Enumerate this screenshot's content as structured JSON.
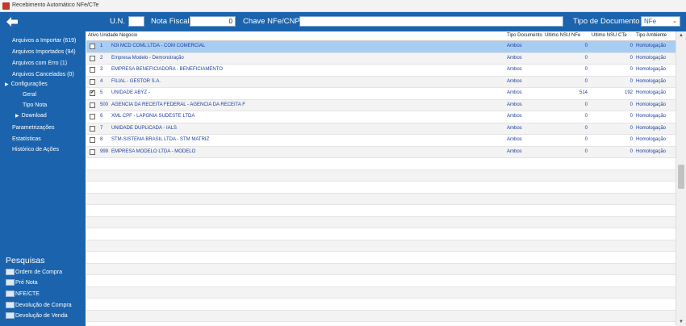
{
  "window": {
    "title": "Recebimento Automático NFe/CTe"
  },
  "topbar": {
    "un_label": "U.N.",
    "un_value": "",
    "nota_label": "Nota Fiscal",
    "nota_value": "0",
    "chave_label": "Chave NFe/CNPJ",
    "chave_value": "",
    "tipo_label": "Tipo de Documento",
    "tipo_value": "NFe"
  },
  "sidebar": {
    "items": [
      {
        "label": "Arquivos a Importar (619)"
      },
      {
        "label": "Arquivos Importados (94)"
      },
      {
        "label": "Arquivos com Erro (1)"
      },
      {
        "label": "Arquivos Cancelados (0)"
      },
      {
        "label": "Configurações"
      },
      {
        "label": "Geral"
      },
      {
        "label": "Tipo Nota"
      },
      {
        "label": "Download"
      },
      {
        "label": "Parametrizações"
      },
      {
        "label": "Estatísticas"
      },
      {
        "label": "Histórico de Ações"
      }
    ],
    "pesquisas_title": "Pesquisas",
    "pesquisas": [
      {
        "label": "Ordem de Compra"
      },
      {
        "label": "Pré Nota"
      },
      {
        "label": "NFE/CTE"
      },
      {
        "label": "Devolução de Compra"
      },
      {
        "label": "Devolução de Venda"
      }
    ]
  },
  "grid": {
    "columns": [
      "Ativo",
      "Unidade Negocio",
      "Tipo Documento",
      "Ultimo NSU NFe",
      "Ultimo NSU CTe",
      "Tipo Ambiente"
    ],
    "rows": [
      {
        "checked": false,
        "code": "1",
        "name": "N3I MCD COML LTDA - COM COMERCIAL",
        "tipo": "Ambos",
        "nsu_nfe": "0",
        "nsu_cte": "0",
        "ambiente": "Homologação"
      },
      {
        "checked": false,
        "code": "2",
        "name": "Empresa Modelo - Demonstração",
        "tipo": "Ambos",
        "nsu_nfe": "0",
        "nsu_cte": "0",
        "ambiente": "Homologação"
      },
      {
        "checked": false,
        "code": "3",
        "name": "EMPRESA BENEFICIADORA - BENEFICIAMENTO",
        "tipo": "Ambos",
        "nsu_nfe": "0",
        "nsu_cte": "0",
        "ambiente": "Homologação"
      },
      {
        "checked": false,
        "code": "4",
        "name": "FILIAL - GESTOR S.A.",
        "tipo": "Ambos",
        "nsu_nfe": "0",
        "nsu_cte": "0",
        "ambiente": "Homologação"
      },
      {
        "checked": true,
        "code": "5",
        "name": "UNIDADE ABYZ -",
        "tipo": "Ambos",
        "nsu_nfe": "514",
        "nsu_cte": "192",
        "ambiente": "Homologação"
      },
      {
        "checked": false,
        "code": "500",
        "name": "AGENCIA DA RECEITA FEDERAL - AGENCIA DA RECEITA F",
        "tipo": "Ambos",
        "nsu_nfe": "0",
        "nsu_cte": "0",
        "ambiente": "Homologação"
      },
      {
        "checked": false,
        "code": "6",
        "name": "XML CPF - LAPONIA SUDESTE LTDA",
        "tipo": "Ambos",
        "nsu_nfe": "0",
        "nsu_cte": "0",
        "ambiente": "Homologação"
      },
      {
        "checked": false,
        "code": "7",
        "name": "UNIDADE DUPLICADA - IALS",
        "tipo": "Ambos",
        "nsu_nfe": "0",
        "nsu_cte": "0",
        "ambiente": "Homologação"
      },
      {
        "checked": false,
        "code": "8",
        "name": "STM-SISTEMA BRASIL LTDA - STM MATRIZ",
        "tipo": "Ambos",
        "nsu_nfe": "0",
        "nsu_cte": "0",
        "ambiente": "Homologação"
      },
      {
        "checked": false,
        "code": "999",
        "name": "EMPRESA MODELO LTDA - MODELO",
        "tipo": "Ambos",
        "nsu_nfe": "0",
        "nsu_cte": "0",
        "ambiente": "Homologação"
      }
    ],
    "empty_rows": 14
  },
  "colors": {
    "primary": "#1b64ad",
    "selected_row": "#a8cdf3",
    "cell_text": "#1c3f9a"
  },
  "icons": {
    "back": "arrow-left-icon",
    "app": "app-icon",
    "expand": "triangle-right-icon"
  }
}
